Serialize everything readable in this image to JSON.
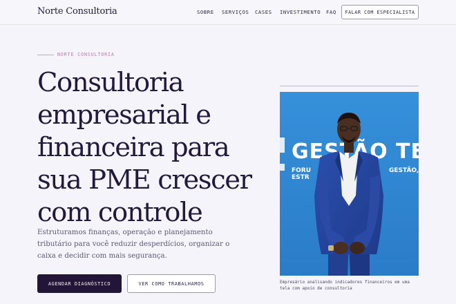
{
  "header": {
    "brand": "Norte Consultoria",
    "nav": [
      "SOBRE",
      "SERVIÇOS",
      "CASES",
      "INVESTIMENTO",
      "FAQ"
    ],
    "cta": "FALAR COM ESPECIALISTA"
  },
  "hero": {
    "eyebrow": "NORTE CONSULTORIA",
    "title_lines": [
      "Consultoria",
      "empresarial e",
      "financeira para",
      "sua PME crescer",
      "com controle"
    ],
    "subtitle": "Estruturamos finanças, operação e planejamento tributário para você reduzir desperdícios, organizar o caixa e decidir com mais segurança.",
    "primary_button": "AGENDAR DIAGNÓSTICO",
    "secondary_button": "VER COMO TRABALHAMOS"
  },
  "photo": {
    "banner_text": "GESTÃO TECH",
    "banner_sub_left": "FORU",
    "banner_sub_right": "GESTÃO,",
    "banner_sub_left2": "ESTR",
    "caption": "Empresário analisando indicadores financeiros em uma tela com apoio de consultoria"
  },
  "colors": {
    "background": "#f5f4fa",
    "primary_dark": "#231537",
    "accent": "#b37aa8",
    "photo_blue": "#2f86d4"
  }
}
